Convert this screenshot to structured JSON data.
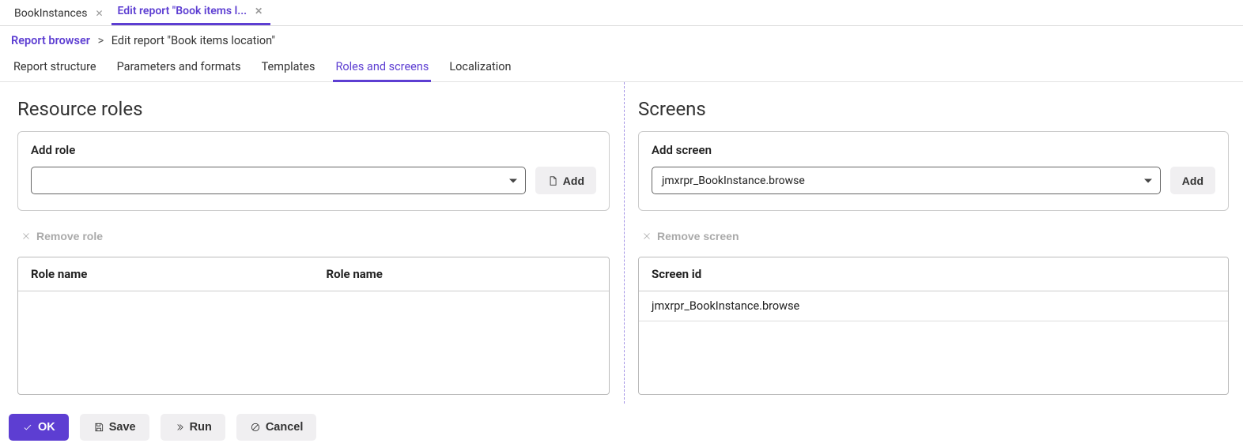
{
  "window_tabs": [
    {
      "label": "BookInstances",
      "active": false
    },
    {
      "label": "Edit report \"Book items l...",
      "active": true
    }
  ],
  "breadcrumb": {
    "root": "Report browser",
    "current": "Edit report \"Book items location\""
  },
  "sub_tabs": [
    {
      "label": "Report structure",
      "active": false
    },
    {
      "label": "Parameters and formats",
      "active": false
    },
    {
      "label": "Templates",
      "active": false
    },
    {
      "label": "Roles and screens",
      "active": true
    },
    {
      "label": "Localization",
      "active": false
    }
  ],
  "roles": {
    "section_title": "Resource roles",
    "panel_label": "Add role",
    "combo_value": "",
    "add_button": "Add",
    "remove_button": "Remove role",
    "columns": [
      "Role name",
      "Role name"
    ],
    "rows": []
  },
  "screens": {
    "section_title": "Screens",
    "panel_label": "Add screen",
    "combo_value": "jmxrpr_BookInstance.browse",
    "add_button": "Add",
    "remove_button": "Remove screen",
    "columns": [
      "Screen id"
    ],
    "rows": [
      {
        "id": "jmxrpr_BookInstance.browse"
      }
    ]
  },
  "footer": {
    "ok": "OK",
    "save": "Save",
    "run": "Run",
    "cancel": "Cancel"
  }
}
